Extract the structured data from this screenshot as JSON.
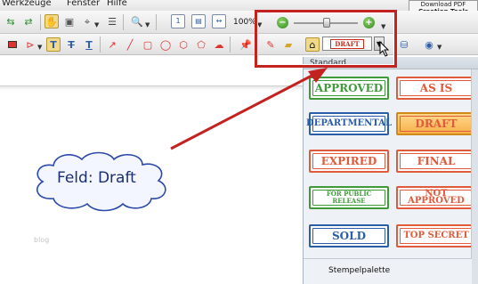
{
  "menu": {
    "items": [
      "Werkzeuge",
      "Fenster",
      "Hilfe"
    ]
  },
  "toolbar": {
    "zoom_value": "100%"
  },
  "tooltip": {
    "line1": "Download PDF",
    "line2": "Creation Tools"
  },
  "stamp_button": {
    "label": "DRAFT"
  },
  "callout": {
    "text": "Feld: Draft"
  },
  "watermark": "blog",
  "palette": {
    "title": "Standard",
    "footer": "Stempelpalette",
    "stamps": [
      {
        "label": "APPROVED",
        "color": "#3f9a3a",
        "selected": false
      },
      {
        "label": "AS IS",
        "color": "#e15a3b",
        "selected": false
      },
      {
        "label": "DEPARTMENTAL",
        "color": "#2a5ea8",
        "selected": false
      },
      {
        "label": "DRAFT",
        "color": "#e15a3b",
        "selected": true
      },
      {
        "label": "EXPIRED",
        "color": "#e15a3b",
        "selected": false
      },
      {
        "label": "FINAL",
        "color": "#e15a3b",
        "selected": false
      },
      {
        "label": "FOR PUBLIC RELEASE",
        "color": "#3f9a3a",
        "selected": false
      },
      {
        "label": "NOT APPROVED",
        "color": "#e15a3b",
        "selected": false
      },
      {
        "label": "SOLD",
        "color": "#2a5ea8",
        "selected": false
      },
      {
        "label": "TOP SECRET",
        "color": "#e15a3b",
        "selected": false
      }
    ]
  },
  "colors": {
    "highlight": "#c42121",
    "callout_text": "#1a2f6e",
    "cloud_border": "#2a49a8",
    "selected_stamp_bg": "#f6b04a"
  }
}
